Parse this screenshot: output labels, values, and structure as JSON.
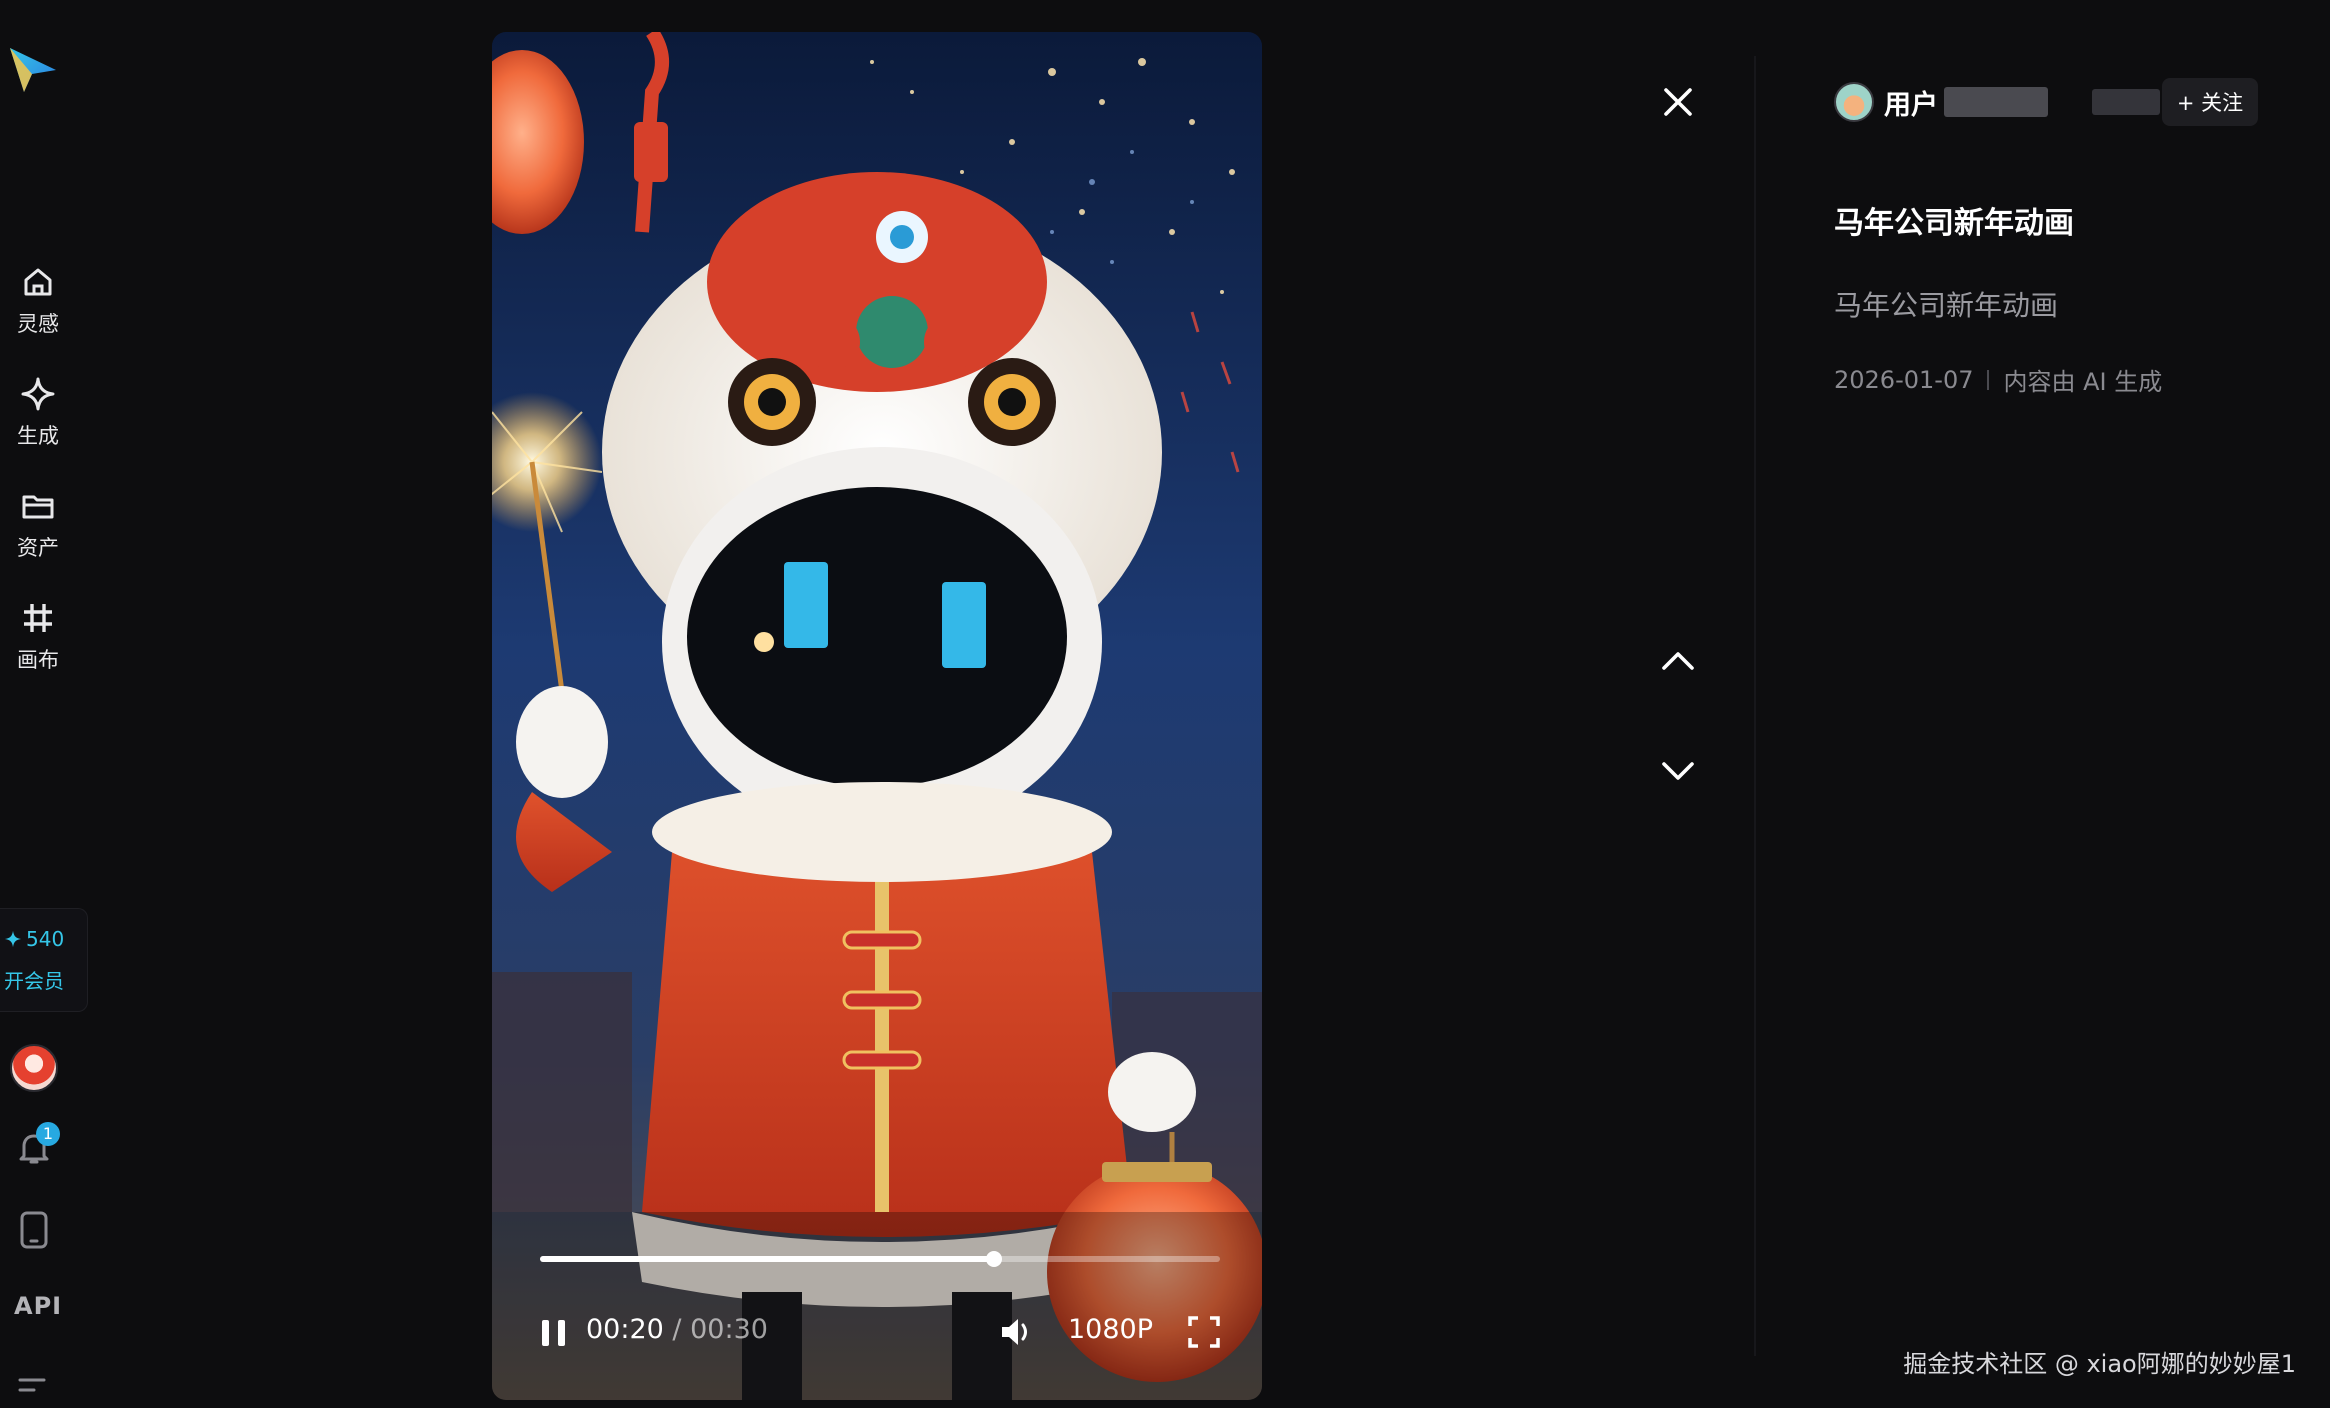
{
  "sidebar": {
    "logo_icon": "paper-plane-logo-icon",
    "items": [
      {
        "label": "灵感",
        "icon": "home-icon"
      },
      {
        "label": "生成",
        "icon": "sparkle-icon"
      },
      {
        "label": "资产",
        "icon": "folder-icon"
      },
      {
        "label": "画布",
        "icon": "canvas-grid-icon"
      }
    ],
    "credits": {
      "icon": "star-icon",
      "value": "540"
    },
    "vip_label": "开会员",
    "notification_count": "1",
    "api_label": "API"
  },
  "player": {
    "current_time": "00:20",
    "separator": "/",
    "total_time": "00:30",
    "progress": 0.667,
    "quality": "1080P"
  },
  "info": {
    "author_label": "用户",
    "follow_label": "+ 关注",
    "title": "马年公司新年动画",
    "description": "马年公司新年动画",
    "date": "2026-01-07",
    "ai_notice": "内容由 AI 生成"
  },
  "watermark": "掘金技术社区 @ xiao阿娜的妙妙屋1",
  "colors": {
    "background": "#0d0d0f",
    "accent": "#35c6e8",
    "badge": "#27a9e1"
  }
}
